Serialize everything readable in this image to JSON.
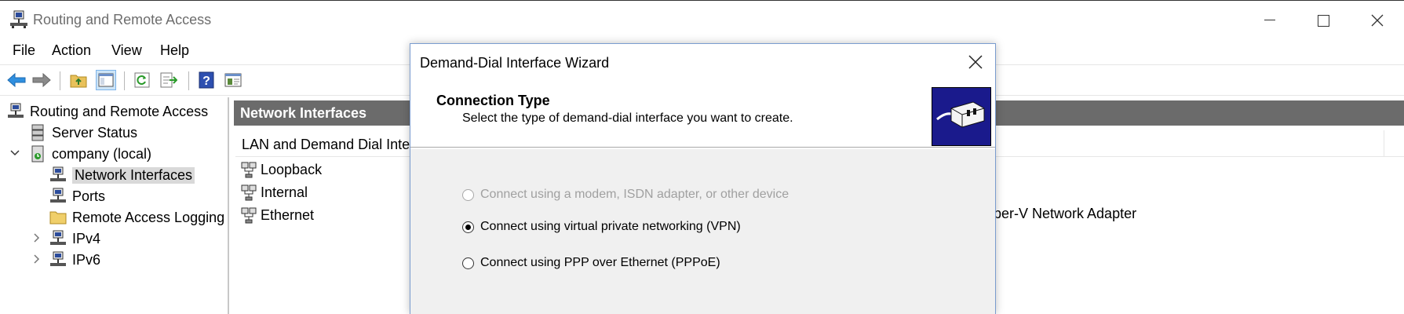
{
  "window": {
    "title": "Routing and Remote Access"
  },
  "menu": [
    "File",
    "Action",
    "View",
    "Help"
  ],
  "toolbar": {
    "icons": [
      "back-icon",
      "forward-icon",
      "up-folder-icon",
      "show-hide-tree-icon",
      "refresh-icon",
      "export-list-icon",
      "help-icon",
      "console-icon"
    ]
  },
  "tree": {
    "root": "Routing and Remote Access",
    "server_status": "Server Status",
    "server": "company (local)",
    "network_interfaces": "Network Interfaces",
    "ports": "Ports",
    "remote_access_logging": "Remote Access Logging",
    "ipv4": "IPv4",
    "ipv6": "IPv6"
  },
  "right_pane": {
    "title": "Network Interfaces",
    "column": "LAN and Demand Dial Inter",
    "rows": [
      "Loopback",
      "Internal",
      "Ethernet"
    ],
    "device_partial": "per-V Network Adapter"
  },
  "dialog": {
    "title": "Demand-Dial Interface Wizard",
    "heading": "Connection Type",
    "subtitle": "Select the type of demand-dial interface you want to create.",
    "options": [
      {
        "label": "Connect using a modem, ISDN adapter, or other device",
        "checked": false,
        "disabled": true
      },
      {
        "label": "Connect using virtual private networking (VPN)",
        "checked": true,
        "disabled": false
      },
      {
        "label": "Connect using PPP over Ethernet (PPPoE)",
        "checked": false,
        "disabled": false
      }
    ]
  },
  "colors": {
    "header_gray": "#6b6b6b",
    "selection": "#d9d9d9",
    "dialog_body": "#f0f0f0",
    "wizard_image": "#1a1a8c"
  }
}
